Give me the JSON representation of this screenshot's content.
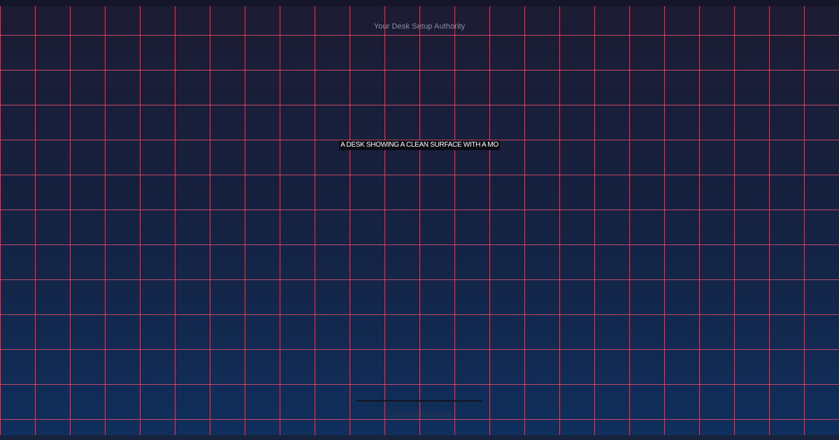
{
  "header": {
    "tagline": "Your Desk Setup Authority"
  },
  "hero": {
    "caption": "A DESK SHOWING A CLEAN SURFACE WITH A MO"
  },
  "footer": {
    "brand": "DeskGearReviews"
  },
  "colors": {
    "grid_line": "#e5506e",
    "background_top": "#1c1c33",
    "background_bottom": "#0f2f5c",
    "caption_bg": "#0b0b14",
    "caption_text": "#ffffff",
    "tagline_text": "#8b8fa3"
  }
}
